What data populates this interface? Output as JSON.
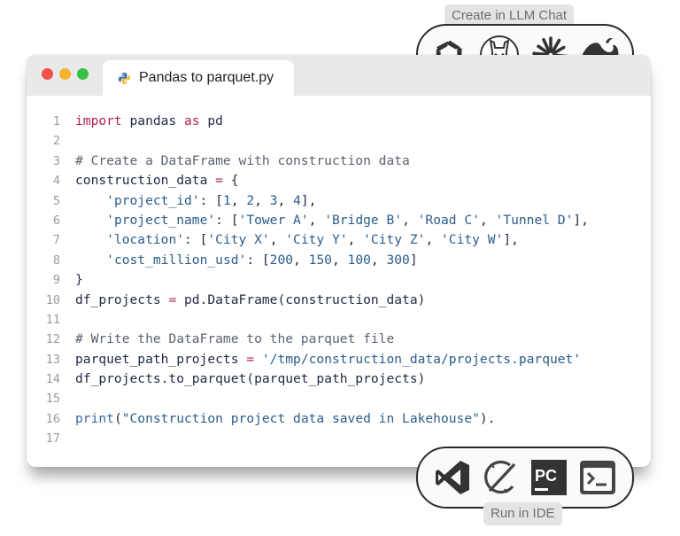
{
  "llm_chat": {
    "label": "Create in LLM Chat",
    "icons": [
      "openai-icon",
      "llama-icon",
      "claude-icon",
      "deepseek-icon"
    ]
  },
  "ide": {
    "label": "Run in IDE",
    "icons": [
      "vscode-icon",
      "eclipse-icon",
      "pycharm-icon",
      "terminal-icon"
    ],
    "pycharm_text": "PC"
  },
  "window": {
    "tab_title": "Pandas to parquet.py",
    "colors": {
      "close": "#f0524a",
      "minimize": "#f4b52c",
      "maximize": "#35c244"
    }
  },
  "code": {
    "lines": [
      [
        [
          "kw",
          "import"
        ],
        [
          "t",
          " pandas "
        ],
        [
          "kw",
          "as"
        ],
        [
          "t",
          " pd"
        ]
      ],
      [],
      [
        [
          "cm",
          "# Create a DataFrame with construction data"
        ]
      ],
      [
        [
          "t",
          "construction_data "
        ],
        [
          "op",
          "="
        ],
        [
          "t",
          " {"
        ]
      ],
      [
        [
          "t",
          "    "
        ],
        [
          "str",
          "'project_id'"
        ],
        [
          "t",
          ": ["
        ],
        [
          "num",
          "1"
        ],
        [
          "t",
          ", "
        ],
        [
          "num",
          "2"
        ],
        [
          "t",
          ", "
        ],
        [
          "num",
          "3"
        ],
        [
          "t",
          ", "
        ],
        [
          "num",
          "4"
        ],
        [
          "t",
          "],"
        ]
      ],
      [
        [
          "t",
          "    "
        ],
        [
          "str",
          "'project_name'"
        ],
        [
          "t",
          ": ["
        ],
        [
          "str",
          "'Tower A'"
        ],
        [
          "t",
          ", "
        ],
        [
          "str",
          "'Bridge B'"
        ],
        [
          "t",
          ", "
        ],
        [
          "str",
          "'Road C'"
        ],
        [
          "t",
          ", "
        ],
        [
          "str",
          "'Tunnel D'"
        ],
        [
          "t",
          "],"
        ]
      ],
      [
        [
          "t",
          "    "
        ],
        [
          "str",
          "'location'"
        ],
        [
          "t",
          ": ["
        ],
        [
          "str",
          "'City X'"
        ],
        [
          "t",
          ", "
        ],
        [
          "str",
          "'City Y'"
        ],
        [
          "t",
          ", "
        ],
        [
          "str",
          "'City Z'"
        ],
        [
          "t",
          ", "
        ],
        [
          "str",
          "'City W'"
        ],
        [
          "t",
          "],"
        ]
      ],
      [
        [
          "t",
          "    "
        ],
        [
          "str",
          "'cost_million_usd'"
        ],
        [
          "t",
          ": ["
        ],
        [
          "num",
          "200"
        ],
        [
          "t",
          ", "
        ],
        [
          "num",
          "150"
        ],
        [
          "t",
          ", "
        ],
        [
          "num",
          "100"
        ],
        [
          "t",
          ", "
        ],
        [
          "num",
          "300"
        ],
        [
          "t",
          "]"
        ]
      ],
      [
        [
          "t",
          "}"
        ]
      ],
      [
        [
          "t",
          "df_projects "
        ],
        [
          "op",
          "="
        ],
        [
          "t",
          " pd.DataFrame(construction_data)"
        ]
      ],
      [],
      [
        [
          "cm",
          "# Write the DataFrame to the parquet file"
        ]
      ],
      [
        [
          "t",
          "parquet_path_projects "
        ],
        [
          "op",
          "="
        ],
        [
          "t",
          " "
        ],
        [
          "str",
          "'/tmp/construction_data/projects.parquet'"
        ]
      ],
      [
        [
          "t",
          "df_projects.to_parquet(parquet_path_projects)"
        ]
      ],
      [],
      [
        [
          "fn",
          "print"
        ],
        [
          "t",
          "("
        ],
        [
          "str",
          "\"Construction project data saved in Lakehouse\""
        ],
        [
          "t",
          ")."
        ]
      ],
      []
    ]
  }
}
